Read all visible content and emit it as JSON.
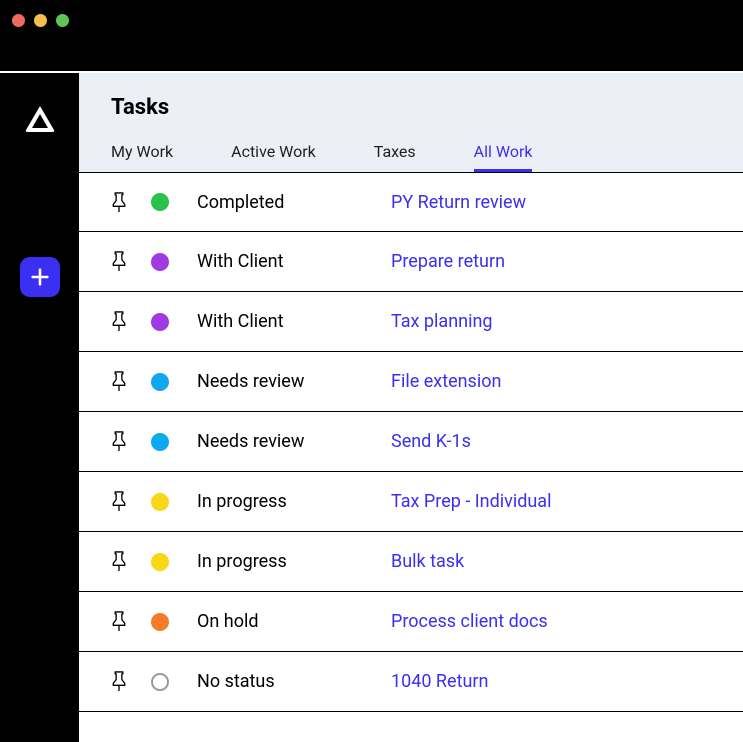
{
  "header": {
    "title": "Tasks"
  },
  "tabs": [
    {
      "label": "My Work",
      "active": false
    },
    {
      "label": "Active Work",
      "active": false
    },
    {
      "label": "Taxes",
      "active": false
    },
    {
      "label": "All Work",
      "active": true
    }
  ],
  "status_colors": {
    "completed": "#29c24a",
    "with_client": "#a23ae2",
    "needs_review": "#0fa8f3",
    "in_progress": "#fad714",
    "on_hold": "#f37d26",
    "no_status": null
  },
  "rows": [
    {
      "status_key": "completed",
      "status": "Completed",
      "task": "PY Return review"
    },
    {
      "status_key": "with_client",
      "status": "With Client",
      "task": "Prepare return"
    },
    {
      "status_key": "with_client",
      "status": "With Client",
      "task": "Tax planning"
    },
    {
      "status_key": "needs_review",
      "status": "Needs review",
      "task": "File extension"
    },
    {
      "status_key": "needs_review",
      "status": "Needs review",
      "task": "Send K-1s"
    },
    {
      "status_key": "in_progress",
      "status": "In progress",
      "task": "Tax Prep - Individual"
    },
    {
      "status_key": "in_progress",
      "status": "In progress",
      "task": "Bulk task"
    },
    {
      "status_key": "on_hold",
      "status": "On hold",
      "task": "Process client docs"
    },
    {
      "status_key": "no_status",
      "status": "No status",
      "task": "1040 Return"
    }
  ],
  "icons": {
    "logo": "triangle-logo",
    "add": "plus-icon",
    "pin": "pin-icon"
  }
}
